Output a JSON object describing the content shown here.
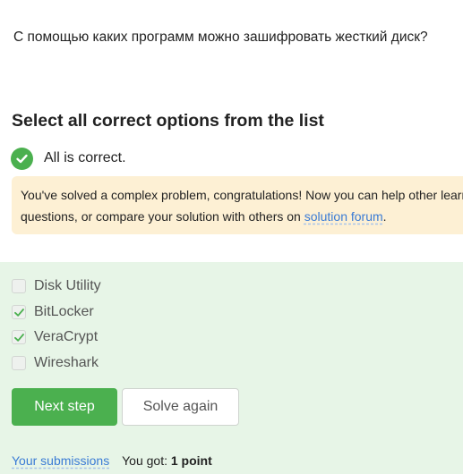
{
  "question": {
    "text": "С помощью каких программ можно зашифровать жесткий диск?"
  },
  "instruction": "Select all correct options from the list",
  "status": {
    "text": "All is correct."
  },
  "feedback": {
    "line1": "You've solved a complex problem, congratulations! Now you can help other learners",
    "line2_prefix": "questions, or compare your solution with others on ",
    "forum_link": "solution forum",
    "line2_suffix": "."
  },
  "options": [
    {
      "label": "Disk Utility",
      "checked": false
    },
    {
      "label": "BitLocker",
      "checked": true
    },
    {
      "label": "VeraCrypt",
      "checked": true
    },
    {
      "label": "Wireshark",
      "checked": false
    }
  ],
  "buttons": {
    "next": "Next step",
    "solve_again": "Solve again"
  },
  "footer": {
    "submissions_link": "Your submissions",
    "got_label": "You got:",
    "points": "1 point"
  },
  "colors": {
    "accent_green": "#4bb04f",
    "feedback_bg": "#fdf0d4",
    "options_bg": "#e7f5e7",
    "link": "#3a7bd5"
  }
}
